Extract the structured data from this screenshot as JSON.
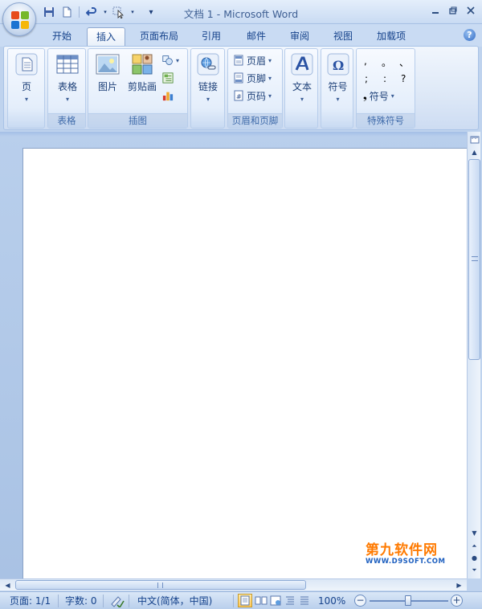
{
  "window": {
    "title": "文档 1 - Microsoft Word"
  },
  "qat": {
    "icons": [
      "save-icon",
      "new-icon",
      "undo-icon",
      "customize-icon",
      "dropdown-icon"
    ]
  },
  "tabs": [
    {
      "label": "开始"
    },
    {
      "label": "插入",
      "active": true
    },
    {
      "label": "页面布局"
    },
    {
      "label": "引用"
    },
    {
      "label": "邮件"
    },
    {
      "label": "审阅"
    },
    {
      "label": "视图"
    },
    {
      "label": "加载项"
    }
  ],
  "ribbon": {
    "pages": {
      "button": "页"
    },
    "tables": {
      "label": "表格",
      "button": "表格"
    },
    "illustrations": {
      "label": "插图",
      "picture": "图片",
      "clipart": "剪贴画"
    },
    "links": {
      "button": "链接"
    },
    "header_footer": {
      "label": "页眉和页脚",
      "header": "页眉",
      "footer": "页脚",
      "page_number": "页码"
    },
    "text": {
      "button": "文本"
    },
    "symbols": {
      "button": "符号"
    },
    "special_symbols": {
      "label": "特殊符号",
      "symbol_button": "符号",
      "chars": [
        ",",
        "。",
        "、",
        ";",
        ":",
        "?",
        "❟"
      ]
    }
  },
  "statusbar": {
    "page": "页面: 1/1",
    "words": "字数: 0",
    "language": "中文(简体，中国)",
    "zoom": "100%",
    "zoom_value": 100
  },
  "watermark": {
    "main": "第九软件网",
    "sub": "WWW.D9SOFT.COM"
  },
  "colors": {
    "ribbon_text": "#15428b",
    "accent_orange": "#ff7a00"
  }
}
